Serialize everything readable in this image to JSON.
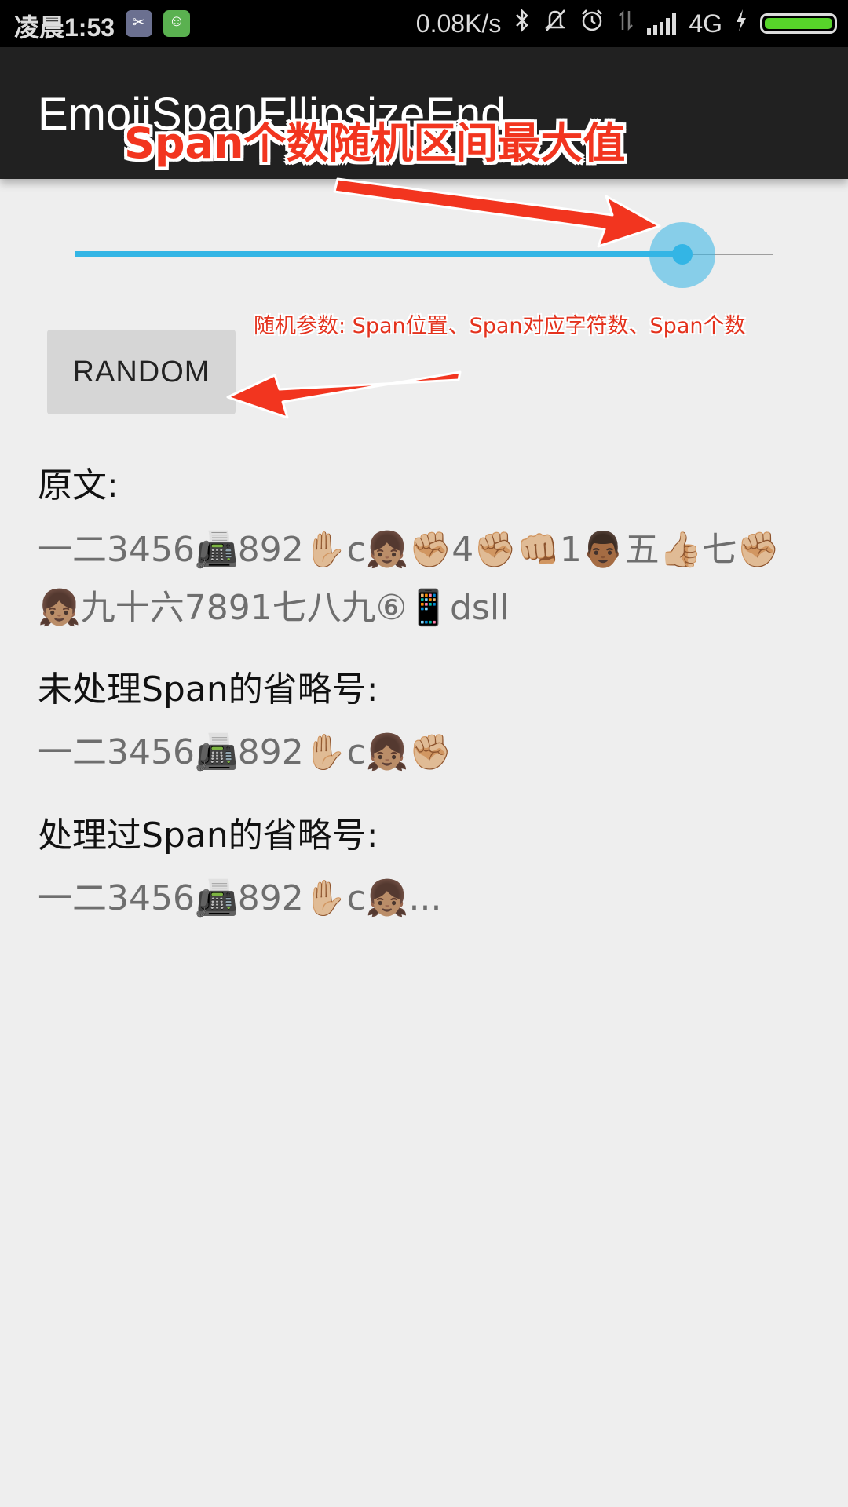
{
  "status_bar": {
    "time": "凌晨1:53",
    "net_speed": "0.08K/s",
    "network": "4G"
  },
  "action_bar": {
    "title": "EmojiSpanEllipsizeEnd"
  },
  "annotations": {
    "slider_note": "Span个数随机区间最大值",
    "button_note": "随机参数: Span位置、Span对应字符数、Span个数",
    "color": "#f2351f"
  },
  "seekbar": {
    "progress_fraction": 0.87,
    "accent_color": "#33b5e5"
  },
  "random_button": {
    "label": "RANDOM"
  },
  "sections": [
    {
      "label": "原文:",
      "text": "一二3456📠892✋🏼c👧🏽✊🏼4✊🏼👊🏼1👨🏾五👍🏼七✊🏼👧🏽九十六7891七八九⑥📱dsll"
    },
    {
      "label": "未处理Span的省略号:",
      "text": "一二3456📠892✋🏼c👧🏽✊🏼"
    },
    {
      "label": "处理过Span的省略号:",
      "text": "一二3456📠892✋🏼c👧🏽..."
    }
  ]
}
